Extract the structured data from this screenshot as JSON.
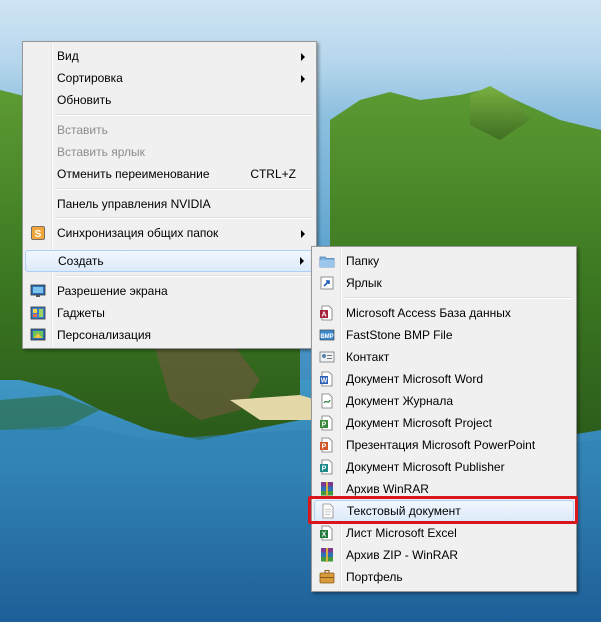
{
  "colors": {
    "highlight_box": "#d9161c",
    "menu_bg": "#f0f0f0"
  },
  "context_menu": {
    "items": [
      {
        "label": "Вид",
        "submenu": true
      },
      {
        "label": "Сортировка",
        "submenu": true
      },
      {
        "label": "Обновить"
      },
      {
        "label": "Вставить",
        "disabled": true
      },
      {
        "label": "Вставить ярлык",
        "disabled": true
      },
      {
        "label": "Отменить переименование",
        "shortcut": "CTRL+Z"
      },
      {
        "label": "Панель управления NVIDIA"
      },
      {
        "label": "Синхронизация общих папок",
        "submenu": true,
        "icon": "sync-folders-icon"
      },
      {
        "label": "Создать",
        "submenu": true,
        "highlighted": true
      },
      {
        "label": "Разрешение экрана",
        "icon": "screen-resolution-icon"
      },
      {
        "label": "Гаджеты",
        "icon": "gadgets-icon"
      },
      {
        "label": "Персонализация",
        "icon": "personalization-icon"
      }
    ]
  },
  "create_submenu": {
    "items": [
      {
        "label": "Папку",
        "icon": "folder-icon"
      },
      {
        "label": "Ярлык",
        "icon": "shortcut-icon"
      },
      {
        "label": "Microsoft Access База данных",
        "icon": "access-icon"
      },
      {
        "label": "FastStone BMP File",
        "icon": "bmp-icon"
      },
      {
        "label": "Контакт",
        "icon": "contact-icon"
      },
      {
        "label": "Документ Microsoft Word",
        "icon": "word-icon"
      },
      {
        "label": "Документ Журнала",
        "icon": "journal-icon"
      },
      {
        "label": "Документ Microsoft Project",
        "icon": "project-icon"
      },
      {
        "label": "Презентация Microsoft PowerPoint",
        "icon": "powerpoint-icon"
      },
      {
        "label": "Документ Microsoft Publisher",
        "icon": "publisher-icon"
      },
      {
        "label": "Архив WinRAR",
        "icon": "winrar-icon"
      },
      {
        "label": "Текстовый документ",
        "icon": "text-document-icon",
        "highlighted": true
      },
      {
        "label": "Лист Microsoft Excel",
        "icon": "excel-icon"
      },
      {
        "label": "Архив ZIP - WinRAR",
        "icon": "winrar-zip-icon"
      },
      {
        "label": "Портфель",
        "icon": "briefcase-icon"
      }
    ]
  }
}
